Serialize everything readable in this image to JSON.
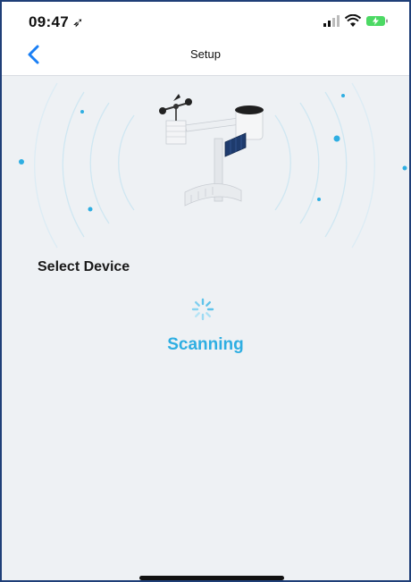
{
  "status_bar": {
    "time": "09:47",
    "location_icon": "location-arrow-icon",
    "icons": [
      "signal-bars-icon",
      "wifi-icon",
      "battery-charging-icon"
    ]
  },
  "nav": {
    "title": "Setup",
    "back_icon": "chevron-left-icon"
  },
  "main": {
    "section_title": "Select Device",
    "status_text": "Scanning",
    "device_image": "weather-station-image"
  },
  "colors": {
    "accent": "#2eaee2",
    "back_arrow": "#1a7ff5",
    "background": "#eef1f4",
    "battery_green": "#4cd964"
  }
}
